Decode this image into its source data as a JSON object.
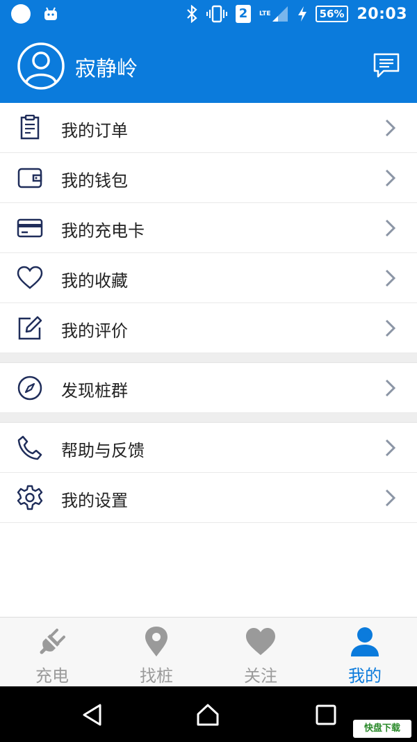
{
  "statusbar": {
    "sim_slot": "2",
    "network": "LTE",
    "battery": "56%",
    "time": "20:03"
  },
  "header": {
    "username": "寂静岭",
    "avatar_icon": "user-avatar-icon",
    "message_icon": "message-icon"
  },
  "menu_groups": [
    [
      {
        "label": "我的订单",
        "icon": "order-icon"
      },
      {
        "label": "我的钱包",
        "icon": "wallet-icon"
      },
      {
        "label": "我的充电卡",
        "icon": "card-icon"
      },
      {
        "label": "我的收藏",
        "icon": "heart-outline-icon"
      },
      {
        "label": "我的评价",
        "icon": "edit-icon"
      }
    ],
    [
      {
        "label": "发现桩群",
        "icon": "compass-icon"
      }
    ],
    [
      {
        "label": "帮助与反馈",
        "icon": "phone-icon"
      },
      {
        "label": "我的设置",
        "icon": "gear-icon"
      }
    ]
  ],
  "tabs": [
    {
      "label": "充电",
      "icon": "plug-icon",
      "active": false
    },
    {
      "label": "找桩",
      "icon": "location-pin-icon",
      "active": false
    },
    {
      "label": "关注",
      "icon": "heart-icon",
      "active": false
    },
    {
      "label": "我的",
      "icon": "person-icon",
      "active": true
    }
  ],
  "colors": {
    "primary": "#0b7bdc",
    "icon_dark": "#1f2d5a",
    "tab_inactive": "#9a9a9a"
  },
  "watermark": "快盘下载"
}
